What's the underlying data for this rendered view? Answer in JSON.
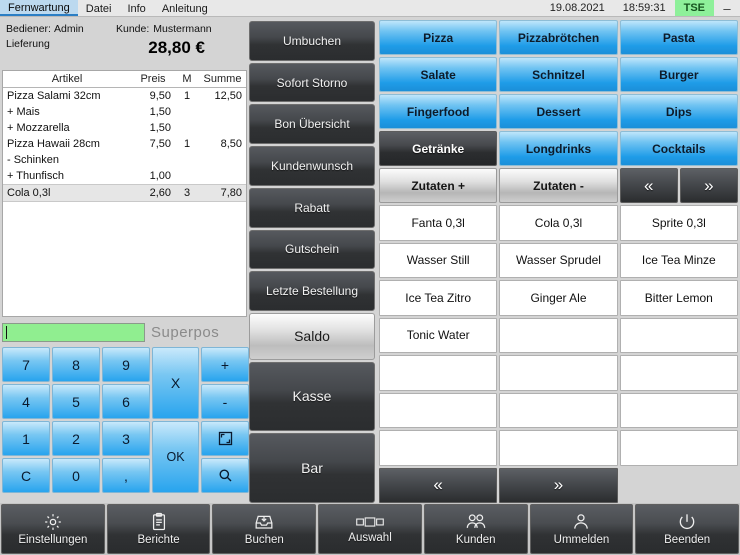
{
  "titlebar": {
    "menu": [
      {
        "label": "Fernwartung",
        "active": true
      },
      {
        "label": "Datei",
        "active": false
      },
      {
        "label": "Info",
        "active": false
      },
      {
        "label": "Anleitung",
        "active": false
      }
    ],
    "date": "19.08.2021",
    "time": "18:59:31",
    "tse_badge": "TSE",
    "minimize_icon": "–",
    "tse_color": "#8ef09a"
  },
  "info": {
    "bediener_label": "Bediener:",
    "bediener_value": "Admin",
    "kunde_label": "Kunde:",
    "kunde_value": "Mustermann",
    "delivery_label": "Lieferung",
    "total": "28,80 €"
  },
  "receipt": {
    "columns": [
      "Artikel",
      "Preis",
      "M",
      "Summe"
    ],
    "rows": [
      {
        "artikel": "Pizza Salami 32cm",
        "preis": "9,50",
        "m": "1",
        "summe": "12,50",
        "selected": false
      },
      {
        "artikel": "+ Mais",
        "preis": "1,50",
        "m": "",
        "summe": "",
        "selected": false
      },
      {
        "artikel": "+ Mozzarella",
        "preis": "1,50",
        "m": "",
        "summe": "",
        "selected": false
      },
      {
        "artikel": "Pizza Hawaii 28cm",
        "preis": "7,50",
        "m": "1",
        "summe": "8,50",
        "selected": false
      },
      {
        "artikel": "- Schinken",
        "preis": "",
        "m": "",
        "summe": "",
        "selected": false
      },
      {
        "artikel": "+ Thunfisch",
        "preis": "1,00",
        "m": "",
        "summe": "",
        "selected": false
      },
      {
        "artikel": "Cola 0,3l",
        "preis": "2,60",
        "m": "3",
        "summe": "7,80",
        "selected": true
      }
    ]
  },
  "keypad": {
    "input_value": "",
    "brand": "Superpos",
    "keys": [
      {
        "label": "7",
        "name": "key-7"
      },
      {
        "label": "8",
        "name": "key-8"
      },
      {
        "label": "9",
        "name": "key-9"
      },
      {
        "label": "X",
        "name": "key-multiply"
      },
      {
        "label": "+",
        "name": "key-plus"
      },
      {
        "label": "4",
        "name": "key-4"
      },
      {
        "label": "5",
        "name": "key-5"
      },
      {
        "label": "6",
        "name": "key-6"
      },
      {
        "label": "-",
        "name": "key-minus"
      },
      {
        "label": "1",
        "name": "key-1"
      },
      {
        "label": "2",
        "name": "key-2"
      },
      {
        "label": "3",
        "name": "key-3"
      },
      {
        "label": "OK",
        "name": "key-ok"
      },
      {
        "label": "C",
        "name": "key-clear"
      },
      {
        "label": "0",
        "name": "key-0"
      },
      {
        "label": ",",
        "name": "key-comma"
      }
    ],
    "icon_fullscreen": "fullscreen-icon",
    "icon_search": "search-icon"
  },
  "actions": [
    {
      "label": "Umbuchen",
      "style": "dark"
    },
    {
      "label": "Sofort Storno",
      "style": "dark"
    },
    {
      "label": "Bon Übersicht",
      "style": "dark"
    },
    {
      "label": "Kundenwunsch",
      "style": "dark"
    },
    {
      "label": "Rabatt",
      "style": "dark"
    },
    {
      "label": "Gutschein",
      "style": "dark"
    },
    {
      "label": "Letzte Bestellung",
      "style": "dark"
    },
    {
      "label": "Saldo",
      "style": "light"
    },
    {
      "label": "Kasse",
      "style": "dark"
    },
    {
      "label": "Bar",
      "style": "dark"
    }
  ],
  "categories": [
    {
      "label": "Pizza",
      "state": "blue"
    },
    {
      "label": "Pizzabrötchen",
      "state": "blue"
    },
    {
      "label": "Pasta",
      "state": "blue"
    },
    {
      "label": "Salate",
      "state": "blue"
    },
    {
      "label": "Schnitzel",
      "state": "blue"
    },
    {
      "label": "Burger",
      "state": "blue"
    },
    {
      "label": "Fingerfood",
      "state": "blue"
    },
    {
      "label": "Dessert",
      "state": "blue"
    },
    {
      "label": "Dips",
      "state": "blue"
    },
    {
      "label": "Getränke",
      "state": "active"
    },
    {
      "label": "Longdrinks",
      "state": "blue"
    },
    {
      "label": "Cocktails",
      "state": "blue"
    },
    {
      "label": "Zutaten +",
      "state": "gray"
    },
    {
      "label": "Zutaten -",
      "state": "gray"
    }
  ],
  "category_nav": {
    "prev": "«",
    "next": "»"
  },
  "products": [
    {
      "label": "Fanta 0,3l"
    },
    {
      "label": "Cola 0,3l"
    },
    {
      "label": "Sprite 0,3l"
    },
    {
      "label": "Wasser Still"
    },
    {
      "label": "Wasser Sprudel"
    },
    {
      "label": "Ice Tea Minze"
    },
    {
      "label": "Ice Tea Zitro"
    },
    {
      "label": "Ginger Ale"
    },
    {
      "label": "Bitter Lemon"
    },
    {
      "label": "Tonic Water"
    },
    {
      "label": ""
    },
    {
      "label": ""
    },
    {
      "label": ""
    },
    {
      "label": ""
    },
    {
      "label": ""
    },
    {
      "label": ""
    },
    {
      "label": ""
    },
    {
      "label": ""
    },
    {
      "label": ""
    },
    {
      "label": ""
    },
    {
      "label": ""
    }
  ],
  "product_nav": {
    "prev": "«",
    "next": "»"
  },
  "taskbar": [
    {
      "label": "Einstellungen",
      "icon": "gear-icon"
    },
    {
      "label": "Berichte",
      "icon": "clipboard-icon"
    },
    {
      "label": "Buchen",
      "icon": "tray-icon"
    },
    {
      "label": "Auswahl",
      "icon": "rectangles-icon"
    },
    {
      "label": "Kunden",
      "icon": "users-icon"
    },
    {
      "label": "Ummelden",
      "icon": "user-icon"
    },
    {
      "label": "Beenden",
      "icon": "power-icon"
    }
  ]
}
